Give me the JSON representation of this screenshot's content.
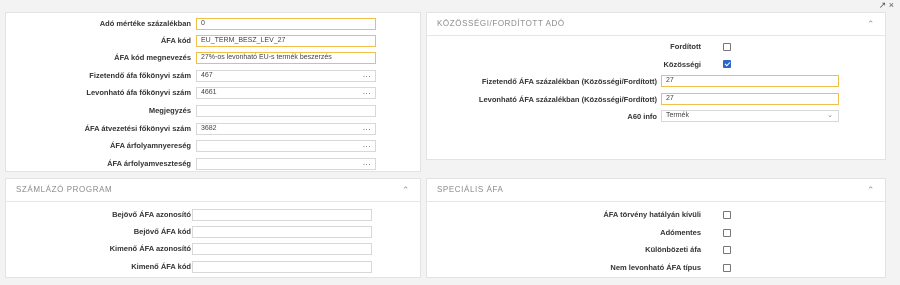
{
  "corner": {
    "symbols": "↗ ×"
  },
  "vat": {
    "rate_label": "Adó mértéke százalékban",
    "rate_value": "0",
    "code_label": "ÁFA kód",
    "code_value": "EU_TERM_BESZ_LEV_27",
    "name_label": "ÁFA kód megnevezés",
    "name_value": "27%-os levonható EU-s termék beszerzés",
    "payable_label": "Fizetendő áfa főkönyvi szám",
    "payable_value": "467",
    "deductible_label": "Levonható áfa főkönyvi szám",
    "deductible_value": "4661",
    "note_label": "Megjegyzés",
    "note_value": "",
    "transfer_label": "ÁFA átvezetési főkönyvi szám",
    "transfer_value": "3682",
    "fxgain_label": "ÁFA árfolyamnyereség",
    "fxgain_value": "",
    "fxloss_label": "ÁFA árfolyamveszteség",
    "fxloss_value": "",
    "dots": "..."
  },
  "community": {
    "title": "KÖZÖSSÉGI/FORDÍTOTT ADÓ",
    "reverse_label": "Fordított",
    "reverse_checked": false,
    "community_label": "Közösségi",
    "community_checked": true,
    "payable_label": "Fizetendő ÁFA százalékban (Közösségi/Fordított)",
    "payable_value": "27",
    "deductible_label": "Levonható ÁFA százalékban (Közösségi/Fordított)",
    "deductible_value": "27",
    "a60_label": "A60 info",
    "a60_value": "Termék"
  },
  "billing": {
    "title": "SZÁMLÁZÓ PROGRAM",
    "in_id_label": "Bejövő ÁFA azonosító",
    "in_id_value": "",
    "in_code_label": "Bejövő ÁFA kód",
    "in_code_value": "",
    "out_id_label": "Kimenő ÁFA azonosító",
    "out_id_value": "",
    "out_code_label": "Kimenő ÁFA kód",
    "out_code_value": ""
  },
  "special": {
    "title": "SPECIÁLIS ÁFA",
    "outside_label": "ÁFA törvény hatályán kívüli",
    "outside_checked": false,
    "exempt_label": "Adómentes",
    "exempt_checked": false,
    "margin_label": "Különbözeti áfa",
    "margin_checked": false,
    "nondeduct_label": "Nem levonható ÁFA típus",
    "nondeduct_checked": false
  },
  "icons": {
    "chevron_up": "⌃",
    "chevron_down": "⌄"
  }
}
